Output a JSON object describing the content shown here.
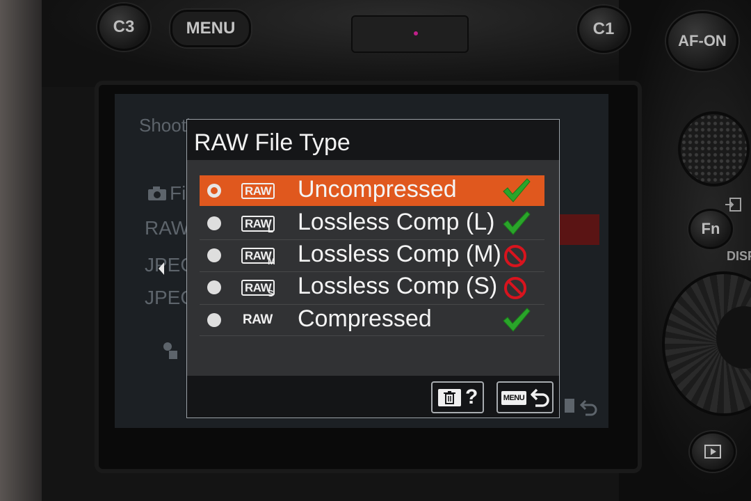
{
  "camera": {
    "buttons": {
      "c3": "C3",
      "menu": "MENU",
      "c1": "C1",
      "af_on": "AF-ON",
      "fn": "Fn"
    },
    "dial_label": "DISP"
  },
  "background_menu": {
    "section_title": "Shooti",
    "items": [
      "Fi",
      "RAW",
      "JPEG",
      "JPEG"
    ]
  },
  "dialog": {
    "title": "RAW File Type",
    "selected_index": 0,
    "options": [
      {
        "icon": "raw-icon",
        "icon_text": "RAW",
        "icon_sub": "",
        "label": "Uncompressed",
        "status": "check-icon"
      },
      {
        "icon": "raw-lossless-l-icon",
        "icon_text": "RAW",
        "icon_sub": "L",
        "label": "Lossless Comp (L)",
        "status": "check-icon"
      },
      {
        "icon": "raw-lossless-m-icon",
        "icon_text": "RAW",
        "icon_sub": "M",
        "label": "Lossless Comp (M)",
        "status": "prohibited-icon"
      },
      {
        "icon": "raw-lossless-s-icon",
        "icon_text": "RAW",
        "icon_sub": "S",
        "label": "Lossless Comp (S)",
        "status": "prohibited-icon"
      },
      {
        "icon": "raw-compressed-icon",
        "icon_text": "RAW",
        "icon_sub": "",
        "label": "Compressed",
        "status": "check-icon"
      }
    ],
    "footer": {
      "help_label": "?",
      "help_icon": "trash-icon",
      "back_badge": "MENU",
      "back_icon": "return-arrow-icon"
    }
  },
  "colors": {
    "selection": "#e0581e",
    "check": "#2aa52a",
    "prohibited": "#d8141e"
  }
}
